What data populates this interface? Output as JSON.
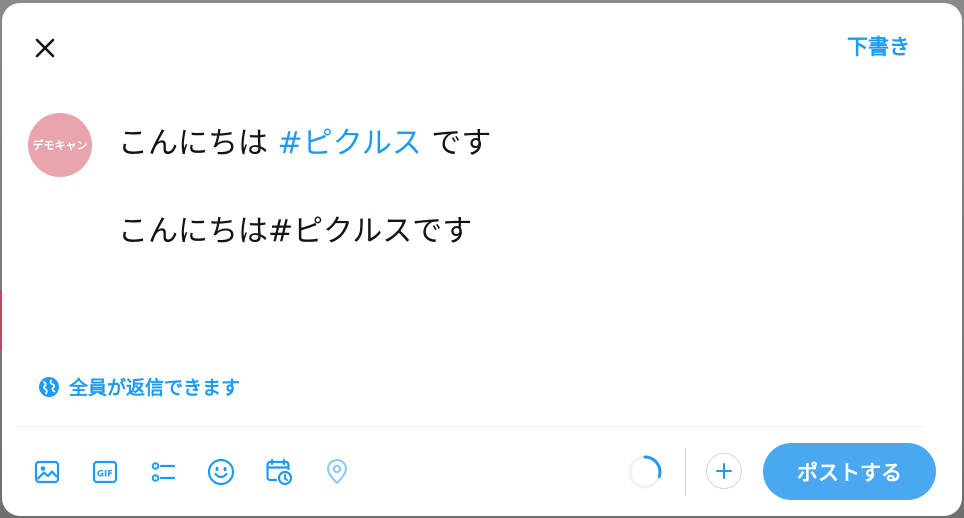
{
  "header": {
    "close_icon": "close-icon",
    "drafts_label": "下書き"
  },
  "avatar": {
    "text": "デモキャン",
    "color": "#e8a3ad"
  },
  "composer": {
    "line1_before": "こんにちは ",
    "line1_hashtag": "#ピクルス",
    "line1_after": " です",
    "line2": "こんにちは#ピクルスです"
  },
  "reply_setting": {
    "icon": "globe-icon",
    "label": "全員が返信できます"
  },
  "toolbar": {
    "tools": [
      "image-icon",
      "gif-icon",
      "poll-icon",
      "emoji-icon",
      "schedule-icon",
      "location-icon"
    ]
  },
  "actions": {
    "add_icon": "plus-icon",
    "post_label": "ポストする",
    "char_progress": 0.3
  },
  "colors": {
    "accent": "#1d9bf0",
    "post_button": "#4aa8f0",
    "text": "#0f1419"
  }
}
